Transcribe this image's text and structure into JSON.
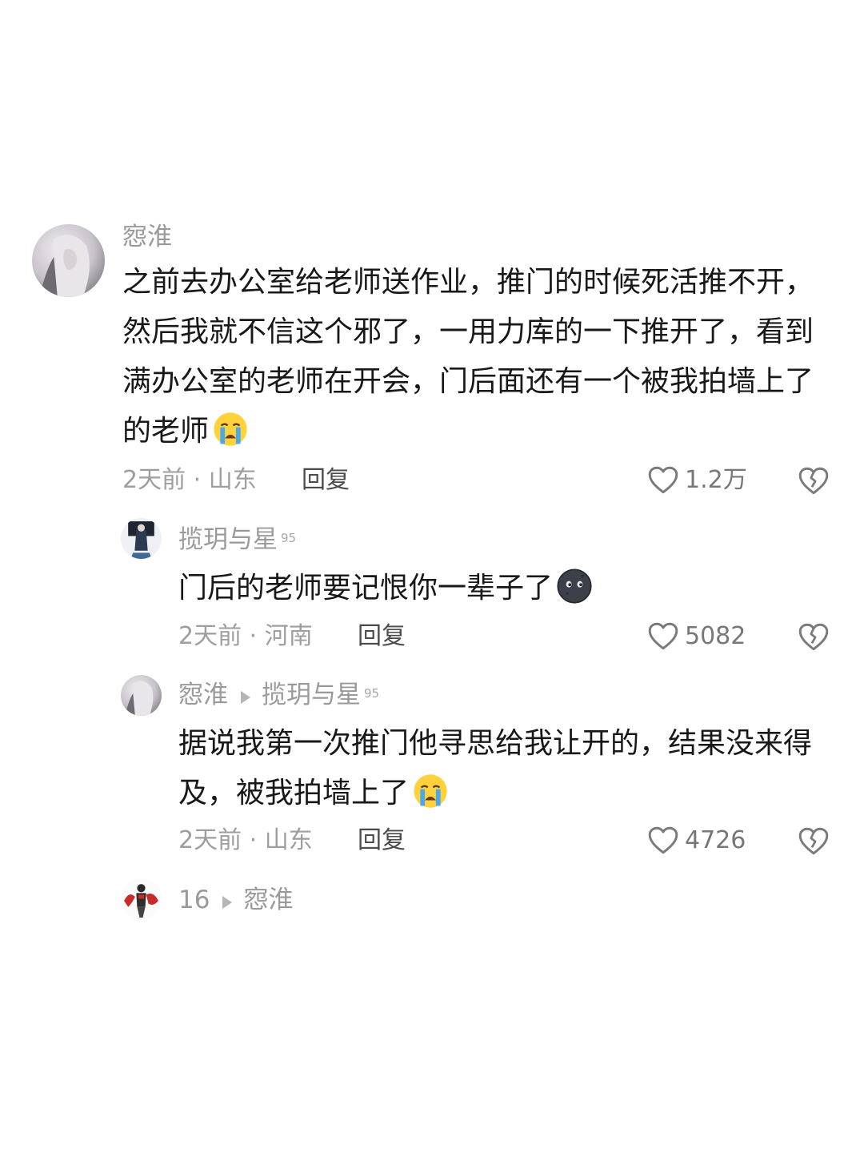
{
  "comments": [
    {
      "author": "惌淮",
      "text": "之前去办公室给老师送作业，推门的时候死活推不开，然后我就不信这个邪了，一用力库的一下推开了，看到满办公室的老师在开会，门后面还有一个被我拍墙上了的老师",
      "emoji": "loudly-crying-face",
      "time": "2天前",
      "location": "山东",
      "reply_label": "回复",
      "likes": "1.2万",
      "replies": [
        {
          "author": "揽玥与星",
          "level": "95",
          "text": "门后的老师要记恨你一辈子了",
          "emoji": "new-moon-face",
          "time": "2天前",
          "location": "河南",
          "reply_label": "回复",
          "likes": "5082"
        },
        {
          "author": "惌淮",
          "reply_to": "揽玥与星",
          "reply_to_level": "95",
          "text": "据说我第一次推门他寻思给我让开的，结果没来得及，被我拍墙上了",
          "emoji": "loudly-crying-face",
          "time": "2天前",
          "location": "山东",
          "reply_label": "回复",
          "likes": "4726"
        },
        {
          "author": "16",
          "reply_to": "惌淮"
        }
      ]
    }
  ],
  "meta_separator": "·",
  "icons": [
    "heart-outline-icon",
    "broken-heart-icon"
  ],
  "colors": {
    "meta": "#9e9e9e",
    "text": "#181818",
    "reply": "#4b4b4b"
  }
}
